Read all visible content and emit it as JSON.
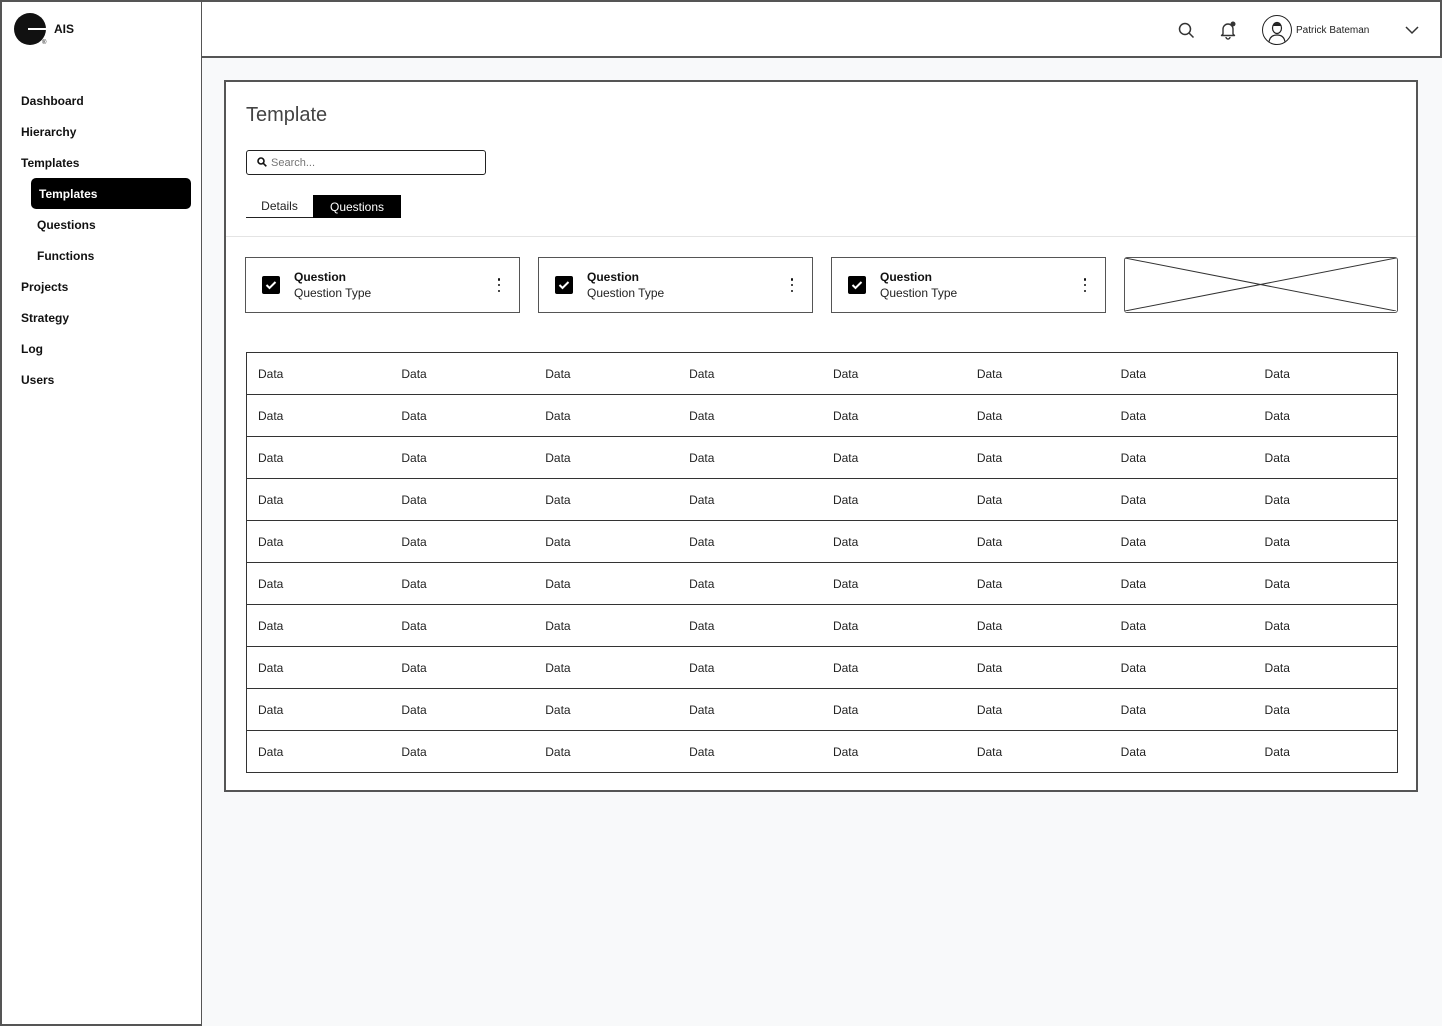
{
  "app": {
    "name": "AIS"
  },
  "header": {
    "user_name": "Patrick Bateman"
  },
  "sidebar": {
    "items": [
      {
        "label": "Dashboard",
        "level": 0,
        "active": false
      },
      {
        "label": "Hierarchy",
        "level": 0,
        "active": false
      },
      {
        "label": "Templates",
        "level": 0,
        "active": false
      },
      {
        "label": "Templates",
        "level": 1,
        "active": true
      },
      {
        "label": "Questions",
        "level": 1,
        "active": false
      },
      {
        "label": "Functions",
        "level": 1,
        "active": false
      },
      {
        "label": "Projects",
        "level": 0,
        "active": false
      },
      {
        "label": "Strategy",
        "level": 0,
        "active": false
      },
      {
        "label": "Log",
        "level": 0,
        "active": false
      },
      {
        "label": "Users",
        "level": 0,
        "active": false
      }
    ]
  },
  "main": {
    "title": "Template",
    "search": {
      "placeholder": "Search..."
    },
    "tabs": [
      {
        "label": "Details",
        "active": false
      },
      {
        "label": "Questions",
        "active": true
      }
    ],
    "question_cards": [
      {
        "title": "Question",
        "subtitle": "Question Type",
        "checked": true
      },
      {
        "title": "Question",
        "subtitle": "Question Type",
        "checked": true
      },
      {
        "title": "Question",
        "subtitle": "Question Type",
        "checked": true
      }
    ],
    "table": {
      "rows": [
        [
          "Data",
          "Data",
          "Data",
          "Data",
          "Data",
          "Data",
          "Data",
          "Data"
        ],
        [
          "Data",
          "Data",
          "Data",
          "Data",
          "Data",
          "Data",
          "Data",
          "Data"
        ],
        [
          "Data",
          "Data",
          "Data",
          "Data",
          "Data",
          "Data",
          "Data",
          "Data"
        ],
        [
          "Data",
          "Data",
          "Data",
          "Data",
          "Data",
          "Data",
          "Data",
          "Data"
        ],
        [
          "Data",
          "Data",
          "Data",
          "Data",
          "Data",
          "Data",
          "Data",
          "Data"
        ],
        [
          "Data",
          "Data",
          "Data",
          "Data",
          "Data",
          "Data",
          "Data",
          "Data"
        ],
        [
          "Data",
          "Data",
          "Data",
          "Data",
          "Data",
          "Data",
          "Data",
          "Data"
        ],
        [
          "Data",
          "Data",
          "Data",
          "Data",
          "Data",
          "Data",
          "Data",
          "Data"
        ],
        [
          "Data",
          "Data",
          "Data",
          "Data",
          "Data",
          "Data",
          "Data",
          "Data"
        ],
        [
          "Data",
          "Data",
          "Data",
          "Data",
          "Data",
          "Data",
          "Data",
          "Data"
        ]
      ]
    }
  },
  "icons": {
    "search": "search-icon",
    "notifications": "bell-icon",
    "avatar": "user-avatar-icon",
    "menu": "chevron-down-icon",
    "card_menu": "kebab-menu-icon",
    "checkbox": "checkbox-checked-icon"
  },
  "colors": {
    "accent": "#000000",
    "background": "#f8f9fa",
    "border": "#555555"
  }
}
